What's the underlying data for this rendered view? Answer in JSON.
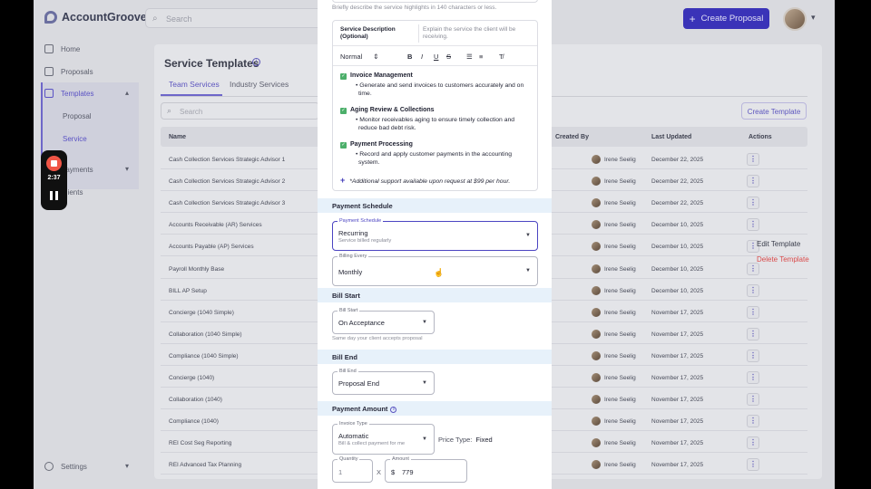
{
  "app": {
    "name": "AccountGroove"
  },
  "topbar": {
    "search_placeholder": "Search",
    "create_label": "Create Proposal"
  },
  "sidebar": {
    "items": [
      {
        "label": "Home"
      },
      {
        "label": "Proposals"
      },
      {
        "label": "Templates"
      },
      {
        "label": "Payments"
      },
      {
        "label": "Clients"
      }
    ],
    "sub_items": [
      "Proposal",
      "Service"
    ],
    "settings_label": "Settings"
  },
  "page": {
    "title": "Service Templates",
    "tabs": [
      "Team Services",
      "Industry Services"
    ],
    "search_placeholder": "Search",
    "create_template_label": "Create Template"
  },
  "table": {
    "headers": {
      "name": "Name",
      "created_by": "Created By",
      "last_updated": "Last Updated",
      "actions": "Actions"
    },
    "rows": [
      {
        "name": "Cash Collection Services Strategic Advisor 1",
        "created_by": "Irene Seelig",
        "updated": "December 22, 2025"
      },
      {
        "name": "Cash Collection Services Strategic Advisor 2",
        "created_by": "Irene Seelig",
        "updated": "December 22, 2025"
      },
      {
        "name": "Cash Collection Services Strategic Advisor 3",
        "created_by": "Irene Seelig",
        "updated": "December 22, 2025"
      },
      {
        "name": "Accounts Receivable (AR) Services",
        "created_by": "Irene Seelig",
        "updated": "December 10, 2025"
      },
      {
        "name": "Accounts Payable (AP) Services",
        "created_by": "Irene Seelig",
        "updated": "December 10, 2025"
      },
      {
        "name": "Payroll Monthly Base",
        "created_by": "Irene Seelig",
        "updated": "December 10, 2025"
      },
      {
        "name": "BILL AP Setup",
        "created_by": "Irene Seelig",
        "updated": "December 10, 2025"
      },
      {
        "name": "Concierge (1040 Simple)",
        "created_by": "Irene Seelig",
        "updated": "November 17, 2025"
      },
      {
        "name": "Collaboration (1040 Simple)",
        "created_by": "Irene Seelig",
        "updated": "November 17, 2025"
      },
      {
        "name": "Compliance (1040 Simple)",
        "created_by": "Irene Seelig",
        "updated": "November 17, 2025"
      },
      {
        "name": "Concierge (1040)",
        "created_by": "Irene Seelig",
        "updated": "November 17, 2025"
      },
      {
        "name": "Collaboration (1040)",
        "created_by": "Irene Seelig",
        "updated": "November 17, 2025"
      },
      {
        "name": "Compliance (1040)",
        "created_by": "Irene Seelig",
        "updated": "November 17, 2025"
      },
      {
        "name": "REI Cost Seg Reporting",
        "created_by": "Irene Seelig",
        "updated": "November 17, 2025"
      },
      {
        "name": "REI Advanced Tax Planning",
        "created_by": "Irene Seelig",
        "updated": "November 17, 2025"
      }
    ]
  },
  "context_menu": {
    "edit": "Edit Template",
    "delete": "Delete Template"
  },
  "recorder": {
    "time": "2:37"
  },
  "sheet": {
    "highlights_hint": "Briefly describe the service highlights in 140 characters or less.",
    "description_label": "Service Description (Optional)",
    "description_placeholder": "Explain the service the client will be receiving.",
    "toolbar": {
      "style": "Normal",
      "bold": "B",
      "italic": "I",
      "underline": "U",
      "strike": "S",
      "ordered": "☰",
      "bullet": "≡",
      "clear": "T̸"
    },
    "items": [
      {
        "title": "Invoice Management",
        "line1": "• Generate and send invoices to customers accurately and on",
        "line2": "time."
      },
      {
        "title": "Aging Review & Collections",
        "line1": "• Monitor receivables aging to ensure timely collection and",
        "line2": "reduce bad debt risk."
      },
      {
        "title": "Payment Processing",
        "line1": "• Record and apply customer payments in the accounting",
        "line2": "system."
      }
    ],
    "additional_note": "*Additional support available upon request at $99 per hour.",
    "payment_schedule": {
      "section": "Payment Schedule",
      "label": "Payment Schedule",
      "value": "Recurring",
      "sub": "Service billed regularly",
      "billing_label": "Billing Every",
      "billing_value": "Monthly"
    },
    "bill_start": {
      "section": "Bill Start",
      "label": "Bill Start",
      "value": "On Acceptance",
      "help": "Same day your client accepts proposal"
    },
    "bill_end": {
      "section": "Bill End",
      "label": "Bill End",
      "value": "Proposal End"
    },
    "payment_amount": {
      "section": "Payment Amount",
      "invoice_label": "Invoice Type",
      "invoice_value": "Automatic",
      "invoice_sub": "Bill & collect payment for me",
      "price_type_label": "Price Type:",
      "price_type_value": "Fixed",
      "quantity_label": "Quantity",
      "quantity_value": "1",
      "times": "X",
      "amount_label": "Amount",
      "currency": "$",
      "amount_value": "779"
    }
  },
  "colors": {
    "primary": "#3a33b8",
    "danger": "#d94a4a",
    "success": "#4caf6a",
    "section_bg": "#e7f1fa"
  }
}
